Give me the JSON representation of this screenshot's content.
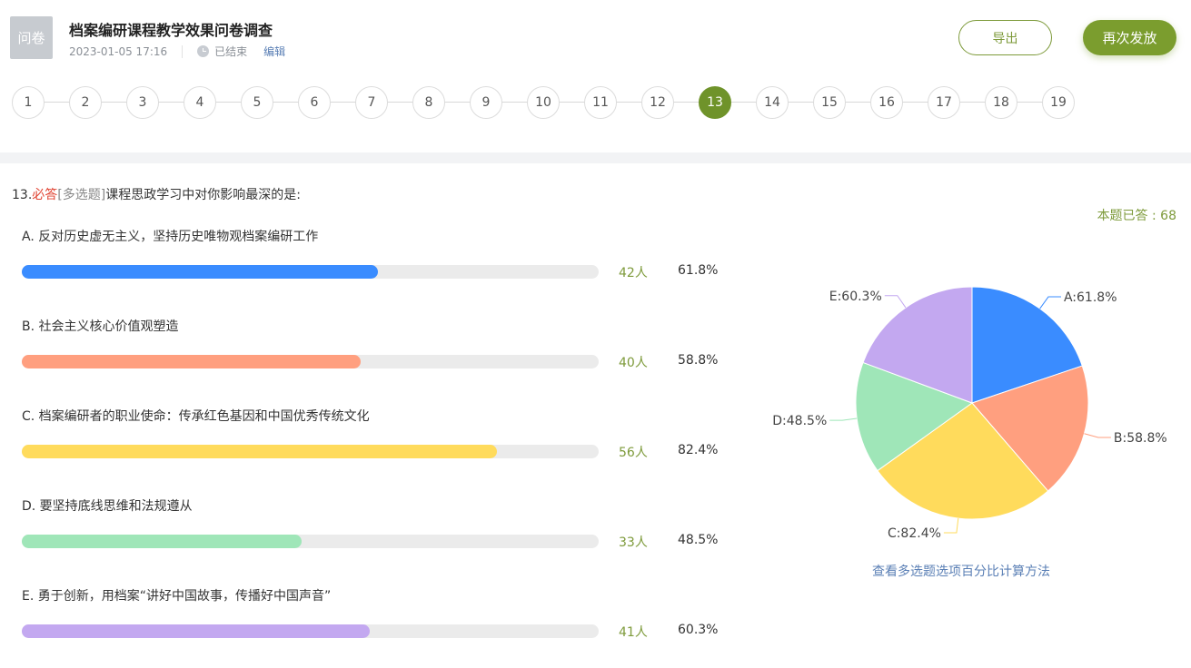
{
  "header": {
    "badge": "问卷",
    "title": "档案编研课程教学效果问卷调查",
    "datetime": "2023-01-05 17:16",
    "status": "已结束",
    "edit": "编辑",
    "export_label": "导出",
    "resend_label": "再次发放"
  },
  "question_nav": {
    "numbers": [
      "1",
      "2",
      "3",
      "4",
      "5",
      "6",
      "7",
      "8",
      "9",
      "10",
      "11",
      "12",
      "13",
      "14",
      "15",
      "16",
      "17",
      "18",
      "19"
    ],
    "active": "13"
  },
  "question": {
    "number": "13.",
    "required": "必答",
    "type": "[多选题]",
    "text": "课程思政学习中对你影响最深的是:",
    "answered": "本题已答 : 68"
  },
  "options": [
    {
      "label": "A. 反对历史虚无主义，坚持历史唯物观档案编研工作",
      "count": "42人",
      "percent": "61.8%",
      "value": 61.8,
      "color": "#3a8cff"
    },
    {
      "label": "B. 社会主义核心价值观塑造",
      "count": "40人",
      "percent": "58.8%",
      "value": 58.8,
      "color": "#ff9f7f"
    },
    {
      "label": "C. 档案编研者的职业使命：传承红色基因和中国优秀传统文化",
      "count": "56人",
      "percent": "82.4%",
      "value": 82.4,
      "color": "#ffdb5c"
    },
    {
      "label": "D. 要坚持底线思维和法规遵从",
      "count": "33人",
      "percent": "48.5%",
      "value": 48.5,
      "color": "#9fe6b8"
    },
    {
      "label": "E. 勇于创新，用档案“讲好中国故事，传播好中国声音”",
      "count": "41人",
      "percent": "60.3%",
      "value": 60.3,
      "color": "#c3a8f0"
    }
  ],
  "chart_data": {
    "type": "pie",
    "categories": [
      "A",
      "B",
      "C",
      "D",
      "E"
    ],
    "values": [
      61.8,
      58.8,
      82.4,
      48.5,
      60.3
    ],
    "labels": [
      "A:61.8%",
      "B:58.8%",
      "C:82.4%",
      "D:48.5%",
      "E:60.3%"
    ],
    "colors": [
      "#3a8cff",
      "#ff9f7f",
      "#ffdb5c",
      "#9fe6b8",
      "#c3a8f0"
    ]
  },
  "footer": {
    "calc_link": "查看多选题选项百分比计算方法"
  }
}
